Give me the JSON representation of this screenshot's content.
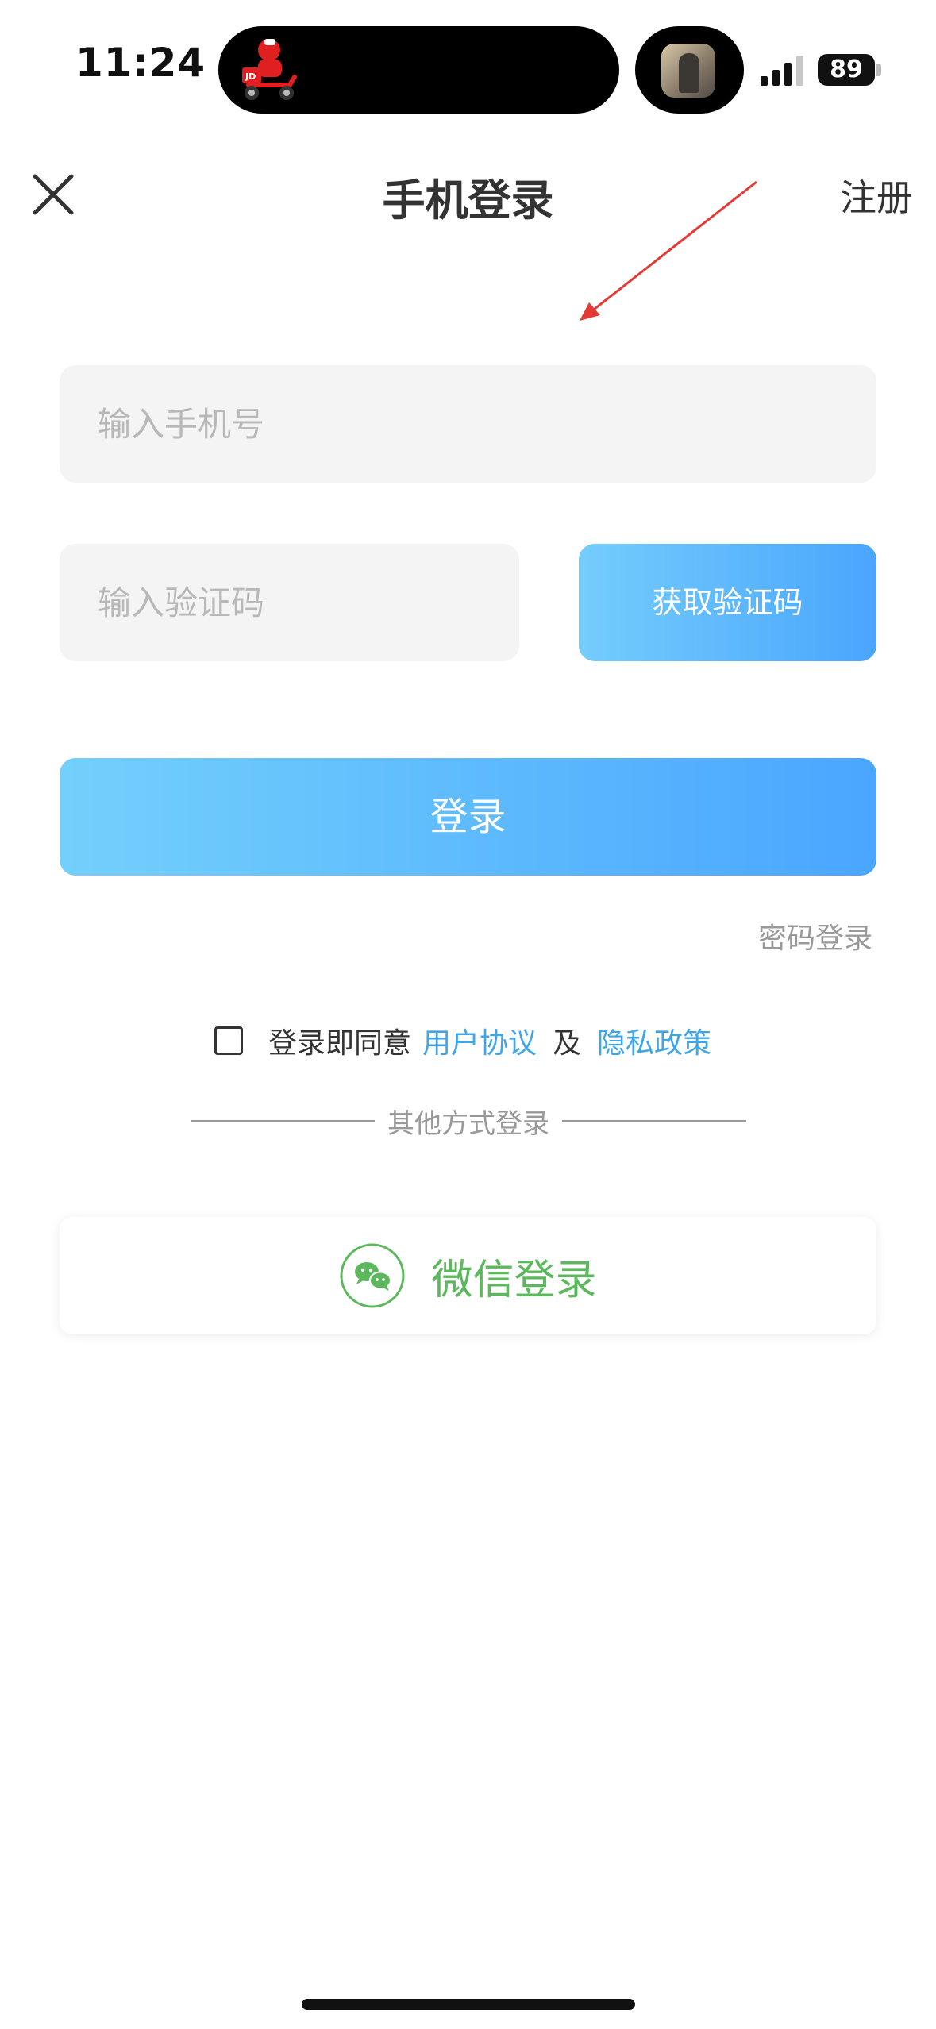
{
  "status_bar": {
    "time": "11:24",
    "battery": "89",
    "island_app_icon": "jd-delivery-scooter-icon",
    "island_thumbnail": "media-thumbnail"
  },
  "nav": {
    "title": "手机登录",
    "register_label": "注册",
    "close_icon": "close-icon"
  },
  "form": {
    "phone_placeholder": "输入手机号",
    "code_placeholder": "输入验证码",
    "get_code_label": "获取验证码",
    "login_label": "登录",
    "password_login_label": "密码登录"
  },
  "agreement": {
    "prefix": "登录即同意",
    "user_agreement": "用户协议",
    "and": "及",
    "privacy_policy": "隐私政策",
    "checked": false
  },
  "other_login": {
    "divider_text": "其他方式登录",
    "wechat_label": "微信登录",
    "wechat_icon": "wechat-icon"
  },
  "colors": {
    "accent_start": "#74cdfb",
    "accent_end": "#4aa5fd",
    "link": "#3ea6e8",
    "wechat_green": "#5cb85c",
    "annotation_red": "#e53935"
  }
}
